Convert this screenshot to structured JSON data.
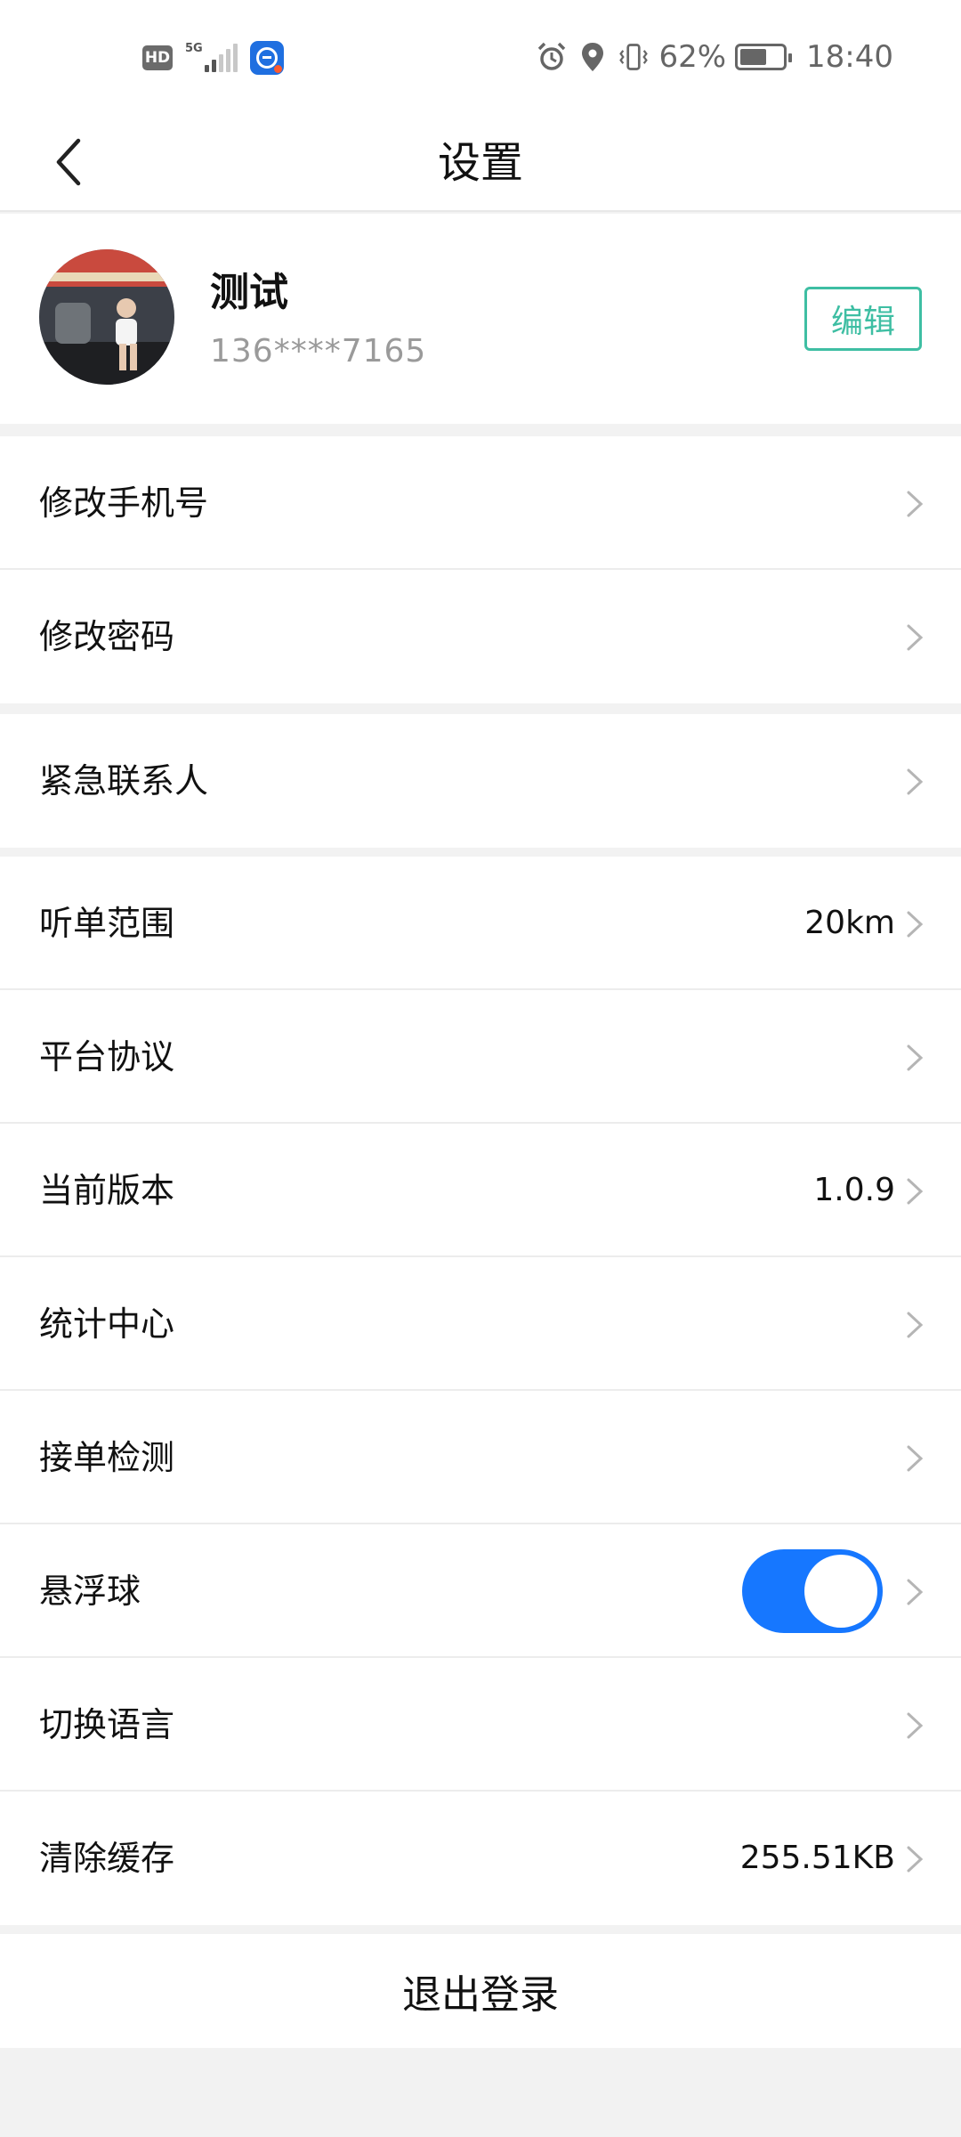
{
  "status_bar": {
    "network_badge": "HD",
    "network_type": "5G",
    "battery_percent": "62%",
    "battery_level": 0.62,
    "time": "18:40",
    "icons": [
      "hd-icon",
      "signal-icon",
      "app-notification-icon",
      "alarm-icon",
      "location-icon",
      "vibrate-icon",
      "battery-icon"
    ]
  },
  "nav": {
    "title": "设置",
    "back_icon": "chevron-left-icon"
  },
  "profile": {
    "name": "测试",
    "phone": "136****7165",
    "edit_label": "编辑"
  },
  "groups": [
    {
      "rows": [
        {
          "label": "修改手机号",
          "value": ""
        },
        {
          "label": "修改密码",
          "value": ""
        }
      ]
    },
    {
      "rows": [
        {
          "label": "紧急联系人",
          "value": ""
        }
      ]
    },
    {
      "rows": [
        {
          "label": "听单范围",
          "value": "20km"
        },
        {
          "label": "平台协议",
          "value": ""
        },
        {
          "label": "当前版本",
          "value": "1.0.9"
        },
        {
          "label": "统计中心",
          "value": ""
        },
        {
          "label": "接单检测",
          "value": ""
        },
        {
          "label": "悬浮球",
          "value": "",
          "toggle_on": true
        },
        {
          "label": "切换语言",
          "value": ""
        },
        {
          "label": "清除缓存",
          "value": "255.51KB"
        }
      ]
    }
  ],
  "logout_label": "退出登录",
  "colors": {
    "accent_green": "#3ebea3",
    "toggle_blue": "#1677ff",
    "background": "#f2f2f2"
  }
}
